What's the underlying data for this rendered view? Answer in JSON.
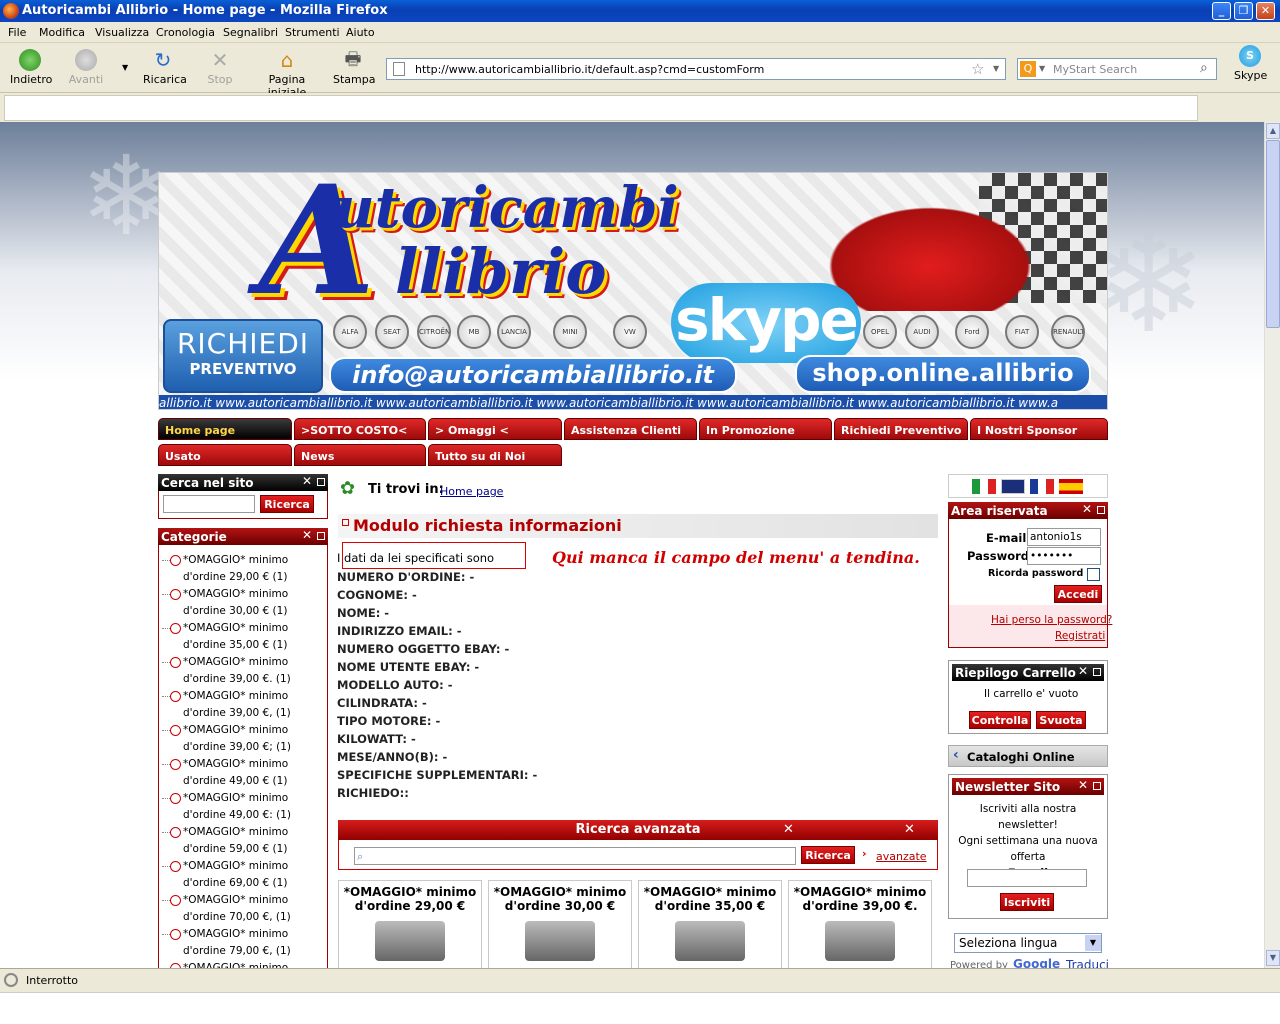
{
  "window": {
    "title": "Autoricambi Allibrio - Home page - Mozilla Firefox"
  },
  "menu": [
    "File",
    "Modifica",
    "Visualizza",
    "Cronologia",
    "Segnalibri",
    "Strumenti",
    "Aiuto"
  ],
  "toolbar": {
    "back": "Indietro",
    "forward": "Avanti",
    "reload": "Ricarica",
    "stop": "Stop",
    "home": "Pagina iniziale",
    "print": "Stampa",
    "skype": "Skype"
  },
  "address": {
    "url": "http://www.autoricambiallibrio.it/default.asp?cmd=customForm"
  },
  "search": {
    "placeholder": "MyStart Search"
  },
  "banner": {
    "logo_line1": "utoricambi",
    "logo_line2": "llibrio",
    "big_letter": "A",
    "richiedi1": "RICHIEDI",
    "richiedi2": "PREVENTIVO",
    "skype": "skype",
    "email": "info@autoricambiallibrio.it",
    "shop": "shop.online.allibrio",
    "ticker": "allibrio.it www.autoricambiallibrio.it www.autoricambiallibrio.it www.autoricambiallibrio.it www.autoricambiallibrio.it www.autoricambiallibrio.it www.a",
    "brands": [
      "ALFA",
      "SEAT",
      "CITROËN",
      "MB",
      "LANCIA",
      "MINI",
      "VW",
      "OPEL",
      "AUDI",
      "Ford",
      "FIAT",
      "RENAULT"
    ]
  },
  "nav": {
    "row1": [
      "Home page",
      ">SOTTO COSTO<",
      "> Omaggi <",
      "Assistenza Clienti",
      "In Promozione",
      "Richiedi Preventivo",
      "I Nostri Sponsor"
    ],
    "row2": [
      "Usato",
      "News",
      "Tutto su di Noi"
    ]
  },
  "left": {
    "search_title": "Cerca nel sito",
    "search_button": "Ricerca",
    "cat_title": "Categorie",
    "categories": [
      "*OMAGGIO* minimo d'ordine 29,00 € (1)",
      "*OMAGGIO* minimo d'ordine 30,00 € (1)",
      "*OMAGGIO* minimo d'ordine 35,00 € (1)",
      "*OMAGGIO* minimo d'ordine 39,00 €. (1)",
      "*OMAGGIO* minimo d'ordine 39,00 €, (1)",
      "*OMAGGIO* minimo d'ordine 39,00 €; (1)",
      "*OMAGGIO* minimo d'ordine 49,00 € (1)",
      "*OMAGGIO* minimo d'ordine 49,00 €: (1)",
      "*OMAGGIO* minimo d'ordine 59,00 € (1)",
      "*OMAGGIO* minimo d'ordine 69,00 € (1)",
      "*OMAGGIO* minimo d'ordine 70,00 €, (1)",
      "*OMAGGIO* minimo d'ordine 79,00 €, (1)",
      "*OMAGGIO* minimo d'ordine"
    ]
  },
  "main": {
    "breadcrumb_label": "Ti trovi in:",
    "breadcrumb_link": "Home page",
    "form_title": "Modulo richiesta informazioni",
    "intro": "I dati da lei specificati sono",
    "annotation": "Qui manca il campo del menu' a tendina.",
    "fields": [
      "NUMERO D'ORDINE: -",
      "COGNOME: -",
      "NOME: -",
      "INDIRIZZO EMAIL: -",
      "NUMERO OGGETTO EBAY: -",
      "NOME UTENTE EBAY: -",
      "MODELLO AUTO: -",
      "CILINDRATA: -",
      "TIPO MOTORE: -",
      "KILOWATT: -",
      "MESE/ANNO(B): -",
      "SPECIFICHE SUPPLEMENTARI: -",
      "RICHIEDO::"
    ],
    "adv_title": "Ricerca avanzata",
    "adv_button": "Ricerca",
    "adv_link": "avanzate",
    "products": [
      {
        "l1": "*OMAGGIO* minimo",
        "l2": "d'ordine 29,00 €"
      },
      {
        "l1": "*OMAGGIO* minimo",
        "l2": "d'ordine 30,00 €"
      },
      {
        "l1": "*OMAGGIO* minimo",
        "l2": "d'ordine 35,00 €"
      },
      {
        "l1": "*OMAGGIO* minimo",
        "l2": "d'ordine 39,00 €."
      }
    ]
  },
  "right": {
    "area_title": "Area riservata",
    "email_label": "E-mail:",
    "email_value": "antonio1s",
    "password_label": "Password:",
    "password_value": "•••••••",
    "remember": "Ricorda password",
    "login": "Accedi",
    "lost": "Hai perso la password?",
    "register": "Registrati",
    "cart_title": "Riepilogo Carrello",
    "cart_empty": "Il carrello e' vuoto",
    "cart_check": "Controlla",
    "cart_empty_btn": "Svuota",
    "catalog": "Cataloghi Online",
    "news_title": "Newsletter Sito",
    "news_text1": "Iscriviti alla nostra newsletter!",
    "news_text2": "Ogni settimana una nuova",
    "news_text3": "offerta",
    "news_email": "E-mail",
    "news_btn": "Iscriviti",
    "lang_select": "Seleziona lingua",
    "powered": "Powered by",
    "google": "Google",
    "translate": "Traduci"
  },
  "status": {
    "text": "Interrotto"
  }
}
